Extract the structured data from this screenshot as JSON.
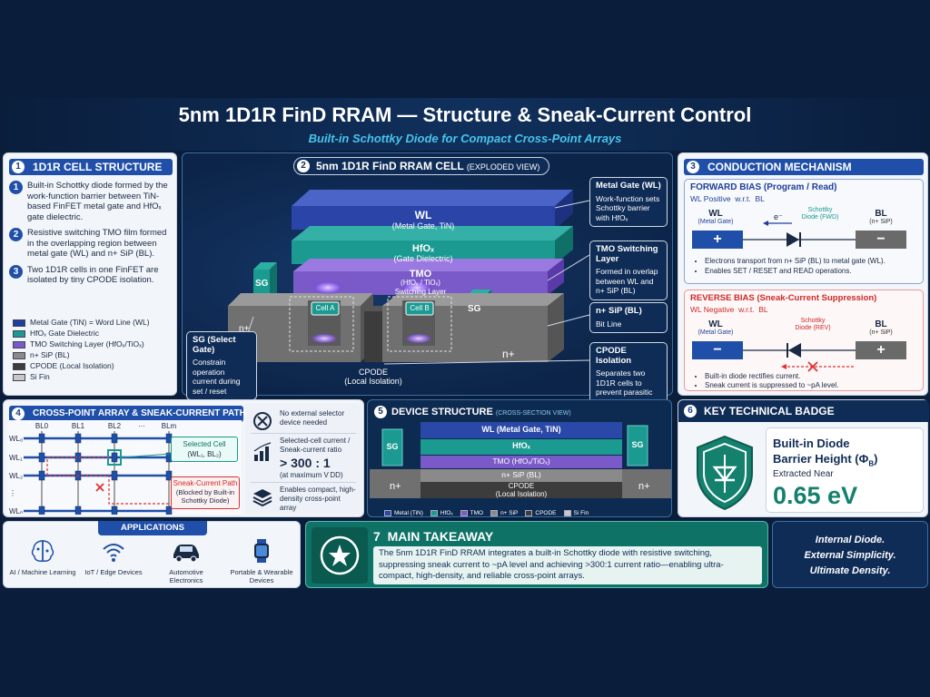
{
  "title": "5nm 1D1R FinD RRAM — Structure & Sneak-Current Control",
  "subtitle": "Built-in Schottky Diode for Compact Cross-Point Arrays",
  "colors": {
    "bg": "#0a1e3c",
    "accent": "#1f4fa8",
    "teal": "#1a9a90",
    "red": "#e03030",
    "purple": "#7a5ac8"
  },
  "panel1": {
    "num": "1",
    "title": "1D1R CELL STRUCTURE",
    "items": [
      {
        "num": "1",
        "text": "Built-in Schottky diode formed by the work-function barrier between TiN-based FinFET metal gate and HfOₓ gate dielectric."
      },
      {
        "num": "2",
        "text": "Resistive switching TMO film formed in the overlapping region between metal gate (WL) and n+ SiP (BL)."
      },
      {
        "num": "3",
        "text": "Two 1D1R cells in one FinFET are isolated by tiny CPODE isolation."
      }
    ],
    "legend": [
      {
        "label": "Metal Gate (TiN) = Word Line (WL)",
        "color": "#1f3f9a"
      },
      {
        "label": "HfOₓ Gate Dielectric",
        "color": "#1a9a90"
      },
      {
        "label": "TMO Switching Layer (HfOₓ/TiOₓ)",
        "color": "#7a5ac8"
      },
      {
        "label": "n+ SiP (BL)",
        "color": "#8a8a8a"
      },
      {
        "label": "CPODE (Local Isolation)",
        "color": "#3c3c3c"
      },
      {
        "label": "Si Fin",
        "color": "#c8c8c8"
      }
    ]
  },
  "panel2": {
    "num": "2",
    "title": "5nm 1D1R FinD RRAM CELL",
    "title_suffix": "(EXPLODED VIEW)",
    "wl_label": "WL",
    "wl_sub": "(Metal Gate, TiN)",
    "hfox_label": "HfOₓ",
    "hfox_sub": "(Gate Dielectric)",
    "tmo_label": "TMO",
    "tmo_sub": "(HfOₓ / TiOₓ)",
    "tmo_sub2": "Switching Layer",
    "sg": "SG",
    "n_plus": "n+",
    "cell_a": "Cell A",
    "cell_b": "Cell B",
    "cpode": "CPODE",
    "cpode_sub": "(Local Isolation)",
    "callouts": {
      "metal_gate": {
        "title": "Metal Gate (WL)",
        "text": "Work-function sets Schottky barrier with HfOₓ"
      },
      "tmo": {
        "title": "TMO Switching Layer",
        "text": "Formed in overlap between WL and n+ SiP (BL)"
      },
      "nsip": {
        "title": "n+ SiP (BL)",
        "text": "Bit Line"
      },
      "cpode": {
        "title": "CPODE Isolation",
        "text": "Separates two 1D1R cells to prevent parasitic junction"
      },
      "sg": {
        "title": "SG (Select Gate)",
        "text": "Constrain operation current during set / reset"
      }
    }
  },
  "panel3": {
    "num": "3",
    "title": "CONDUCTION MECHANISM",
    "forward": {
      "title": "FORWARD BIAS (Program / Read)",
      "bias": "WL Positive  w.r.t.  BL",
      "wl": "WL",
      "wl_sub": "(Metal Gate)",
      "bl": "BL",
      "bl_sub": "(n+ SiP)",
      "electron": "e⁻",
      "diode": "Schottky Diode (FWD)",
      "plus": "+",
      "minus": "−",
      "bullets": [
        "Electrons transport from n+ SiP (BL) to metal gate (WL).",
        "Enables SET / RESET and READ operations."
      ]
    },
    "reverse": {
      "title": "REVERSE BIAS (Sneak-Current Suppression)",
      "bias": "WL Negative  w.r.t.  BL",
      "wl": "WL",
      "wl_sub": "(Metal Gate)",
      "bl": "BL",
      "bl_sub": "(n+ SiP)",
      "diode": "Schottky Diode (REV)",
      "minus": "−",
      "plus": "+",
      "bullets": [
        "Built-in diode rectifies current.",
        "Sneak current is suppressed to ~pA level."
      ]
    }
  },
  "panel4": {
    "num": "4",
    "title": "CROSS-POINT ARRAY & SNEAK-CURRENT PATH",
    "bl_labels": [
      "BL0",
      "BL1",
      "BL2",
      "···",
      "BLm"
    ],
    "wl_labels": [
      "WL₀",
      "WL₁",
      "WL₂",
      "⋮",
      "WLₙ"
    ],
    "selected": "Selected Cell",
    "selected_sub": "(WL₁, BL₂)",
    "sneak": "Sneak-Current Path",
    "sneak_sub": "(Blocked by Built-in Schottky Diode)",
    "features": [
      {
        "icon": "no-selector-icon",
        "text": "No external selector device needed"
      },
      {
        "icon": "bar-chart-icon",
        "text": "Selected-cell current / Sneak-current ratio",
        "value": "> 300 : 1",
        "sub": "(at maximum V DD)"
      },
      {
        "icon": "layers-icon",
        "text": "Enables compact, high-density cross-point array"
      }
    ]
  },
  "panel5": {
    "num": "5",
    "title": "DEVICE STRUCTURE",
    "title_suffix": "(CROSS-SECTION VIEW)",
    "wl": "WL (Metal Gate, TiN)",
    "hfox": "HfOₓ",
    "tmo": "TMO (HfOₓ/TiOₓ)",
    "nsip": "n+ SiP (BL)",
    "cpode": "CPODE",
    "cpode_sub": "(Local Isolation)",
    "sg": "SG",
    "n_plus": "n+",
    "legend": [
      {
        "label": "Metal (TiN)",
        "color": "#2a48a8"
      },
      {
        "label": "HfOₓ",
        "color": "#1a9a90"
      },
      {
        "label": "TMO",
        "color": "#7a5ac8"
      },
      {
        "label": "n+ SiP",
        "color": "#8a8a8a"
      },
      {
        "label": "CPODE",
        "color": "#3c3c3c"
      },
      {
        "label": "Si Fin",
        "color": "#c8c8c8"
      }
    ]
  },
  "panel6": {
    "num": "6",
    "title": "KEY TECHNICAL BADGE",
    "line1": "Built-in Diode",
    "line2": "Barrier Height (Φ",
    "line2_sub": "B",
    "line2_end": ")",
    "extracted": "Extracted Near",
    "value": "0.65 eV"
  },
  "applications": {
    "title": "APPLICATIONS",
    "items": [
      {
        "icon": "brain-icon",
        "label": "AI / Machine Learning"
      },
      {
        "icon": "wifi-icon",
        "label": "IoT / Edge Devices"
      },
      {
        "icon": "car-icon",
        "label": "Automotive Electronics"
      },
      {
        "icon": "watch-icon",
        "label": "Portable & Wearable Devices"
      }
    ]
  },
  "takeaway": {
    "title": "7  MAIN TAKEAWAY",
    "text": "The 5nm 1D1R FinD RRAM integrates a built-in Schottky diode with resistive switching, suppressing sneak current to ~pA level and achieving >300:1 current ratio—enabling ultra-compact, high-density, and reliable cross-point arrays."
  },
  "tagline": [
    "Internal Diode.",
    "External Simplicity.",
    "Ultimate Density."
  ]
}
